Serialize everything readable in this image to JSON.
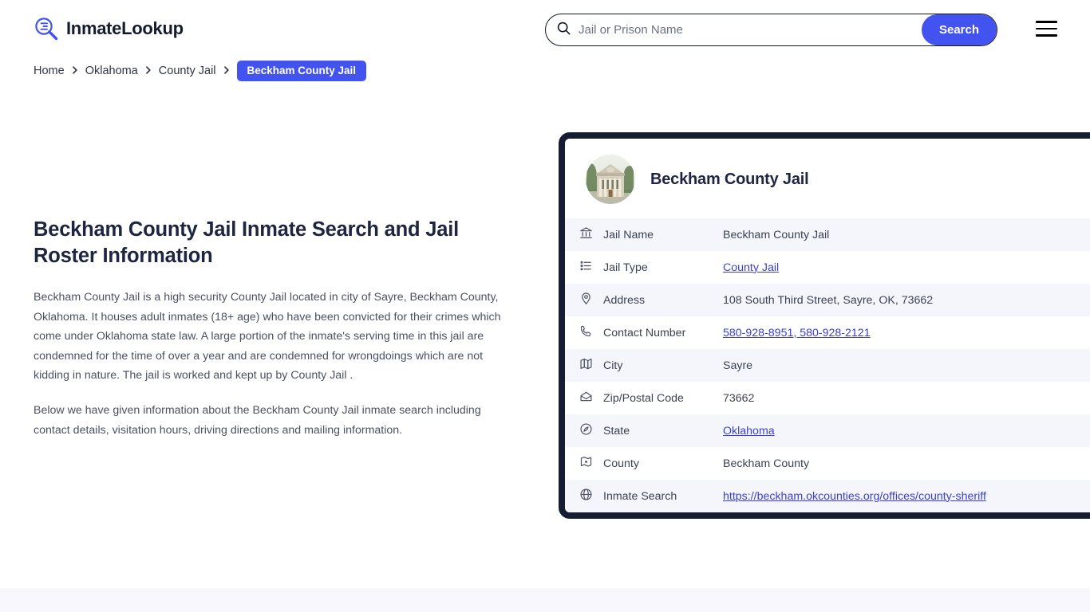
{
  "header": {
    "logo_text": "InmateLookup",
    "logo_icon": "magnifier-list-icon",
    "menu_icon": "hamburger-menu-icon"
  },
  "search": {
    "icon": "search-icon",
    "placeholder": "Jail or Prison Name",
    "value": "",
    "button_label": "Search"
  },
  "breadcrumb": {
    "items": [
      {
        "label": "Home",
        "active": false
      },
      {
        "label": "Oklahoma",
        "active": false
      },
      {
        "label": "County Jail",
        "active": false
      },
      {
        "label": "Beckham County Jail",
        "active": true
      }
    ]
  },
  "main": {
    "title": "Beckham County Jail Inmate Search and Jail Roster Information",
    "paragraphs": [
      "Beckham County Jail is a high security County Jail located in city of Sayre, Beckham County, Oklahoma. It houses adult inmates (18+ age) who have been convicted for their crimes which come under Oklahoma state law. A large portion of the inmate's serving time in this jail are condemned for the time of over a year and are condemned for wrongdoings which are not kidding in nature. The jail is worked and kept up by County Jail .",
      "Below we have given information about the Beckham County Jail inmate search including contact details, visitation hours, driving directions and mailing information."
    ]
  },
  "card": {
    "avatar_icon": "courthouse-photo",
    "title": "Beckham County Jail",
    "rows": [
      {
        "icon": "bank-icon",
        "label": "Jail Name",
        "value": "Beckham County Jail",
        "link": false
      },
      {
        "icon": "list-icon",
        "label": "Jail Type",
        "value": "County Jail",
        "link": true
      },
      {
        "icon": "map-pin-icon",
        "label": "Address",
        "value": "108 South Third Street, Sayre, OK, 73662",
        "link": false
      },
      {
        "icon": "phone-icon",
        "label": "Contact Number",
        "value": "580-928-8951, 580-928-2121",
        "link": true
      },
      {
        "icon": "map-icon",
        "label": "City",
        "value": "Sayre",
        "link": false
      },
      {
        "icon": "envelope-icon",
        "label": "Zip/Postal Code",
        "value": "73662",
        "link": false
      },
      {
        "icon": "compass-icon",
        "label": "State",
        "value": "Oklahoma",
        "link": true
      },
      {
        "icon": "county-icon",
        "label": "County",
        "value": "Beckham County",
        "link": false
      },
      {
        "icon": "globe-icon",
        "label": "Inmate Search",
        "value": "https://beckham.okcounties.org/offices/county-sheriff",
        "link": true
      }
    ]
  },
  "colors": {
    "accent_blue": "#4353f0",
    "link_blue": "#3b3fd4",
    "card_border": "#161d33",
    "row_stripe": "#f5f6fc",
    "heading": "#1e2541",
    "body_text": "#4b5160",
    "footer_band": "#f7f7fd"
  }
}
